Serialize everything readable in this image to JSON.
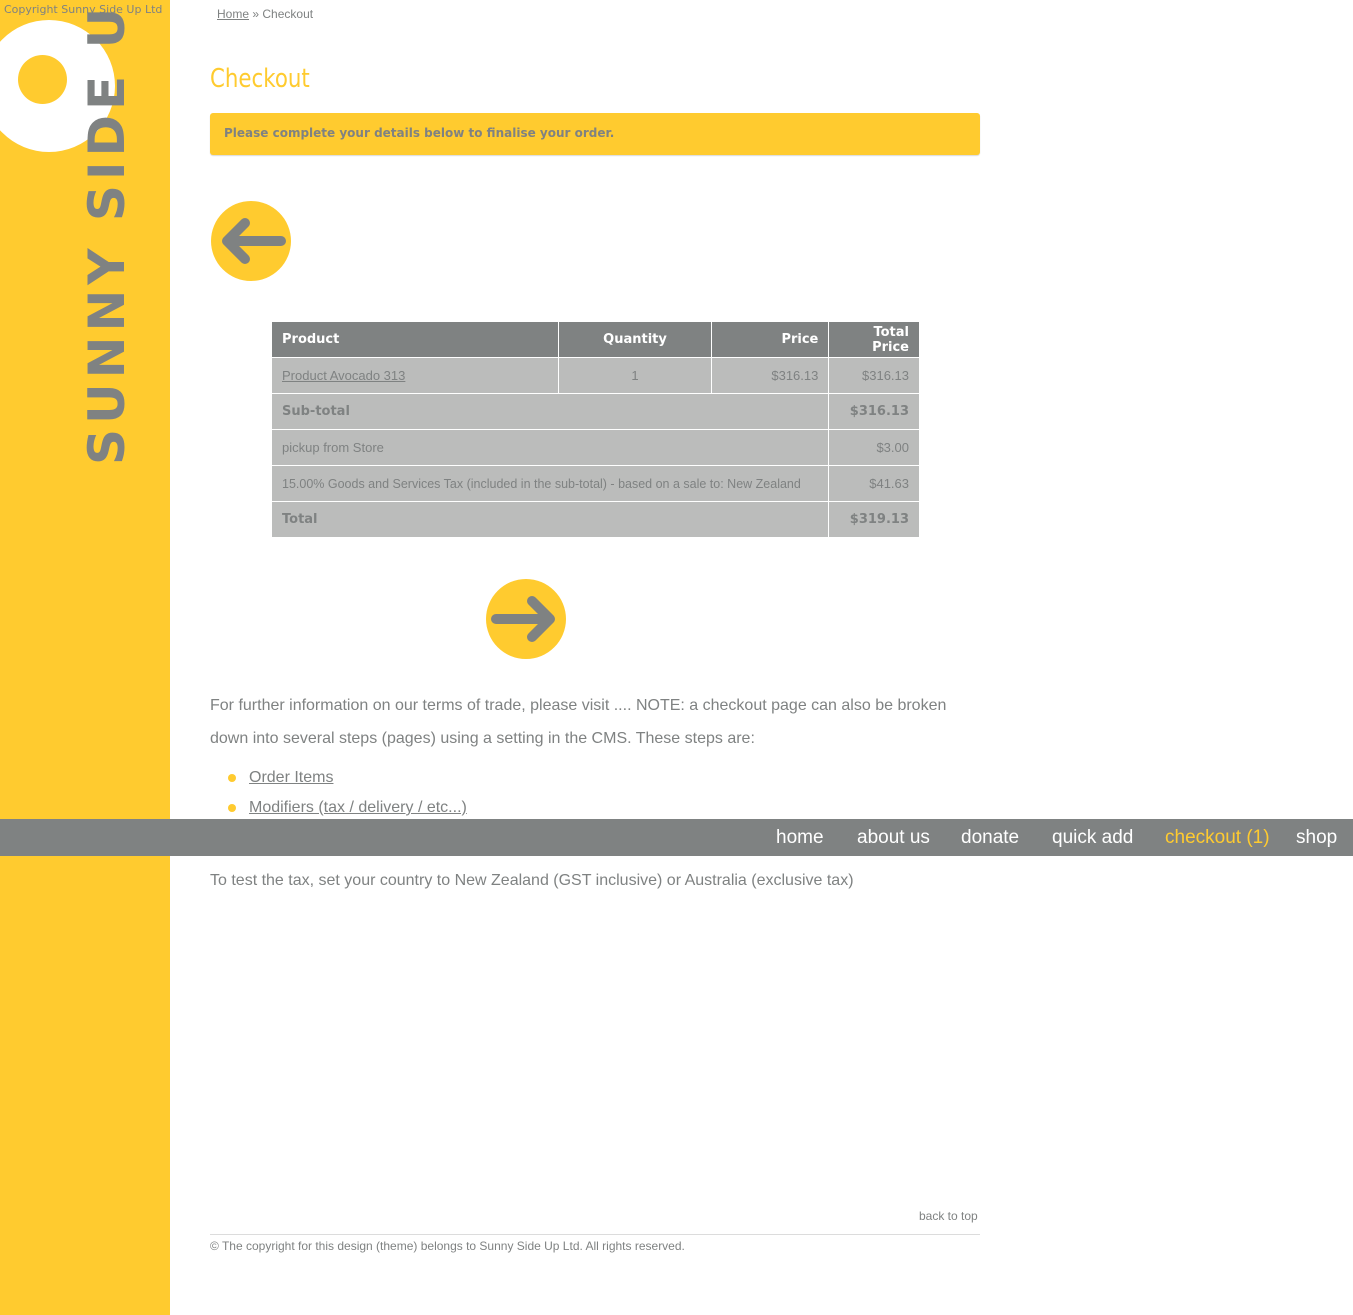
{
  "site": {
    "copyright_top": "Copyright Sunny Side Up Ltd",
    "logo_text": "SUNNY SIDE UP"
  },
  "breadcrumb": {
    "home": "Home",
    "separator": "»",
    "current": "Checkout"
  },
  "page": {
    "title": "Checkout",
    "notice": "Please complete your details below to finalise your order."
  },
  "icons": {
    "back": "arrow-left-icon",
    "next": "arrow-right-icon"
  },
  "order_table": {
    "headers": [
      "Product",
      "Quantity",
      "Price",
      "Total Price"
    ],
    "item": {
      "product": "Product Avocado 313",
      "quantity": "1",
      "price": "$316.13",
      "total": "$316.13"
    },
    "subtotal": {
      "label": "Sub-total",
      "value": "$316.13"
    },
    "pickup": {
      "label": "pickup from Store",
      "value": "$3.00"
    },
    "tax": {
      "label": "15.00% Goods and Services Tax (included in the sub-total) - based on a sale to: New Zealand",
      "value": "$41.63"
    },
    "total": {
      "label": "Total",
      "value": "$319.13"
    }
  },
  "info_text": "For further information on our terms of trade, please visit .... NOTE: a checkout page can also be broken down into several steps (pages) using a setting in the CMS. These steps are:",
  "steps": [
    "Order Items",
    "Modifiers (tax / delivery / etc...)"
  ],
  "nav": {
    "home": "home",
    "about": "about us",
    "donate": "donate",
    "quick_add": "quick add",
    "checkout": "checkout (1)",
    "shop": "shop"
  },
  "tax_text": "To test the tax, set your country to New Zealand (GST inclusive) or Australia (exclusive tax)",
  "footer": {
    "back_to_top": "back to top",
    "copyright": "© The copyright for this design (theme) belongs to Sunny Side Up Ltd. All rights reserved."
  },
  "colors": {
    "accent": "#ffcb2f",
    "grey": "#7f8282",
    "cell": "#bbbcbb"
  }
}
